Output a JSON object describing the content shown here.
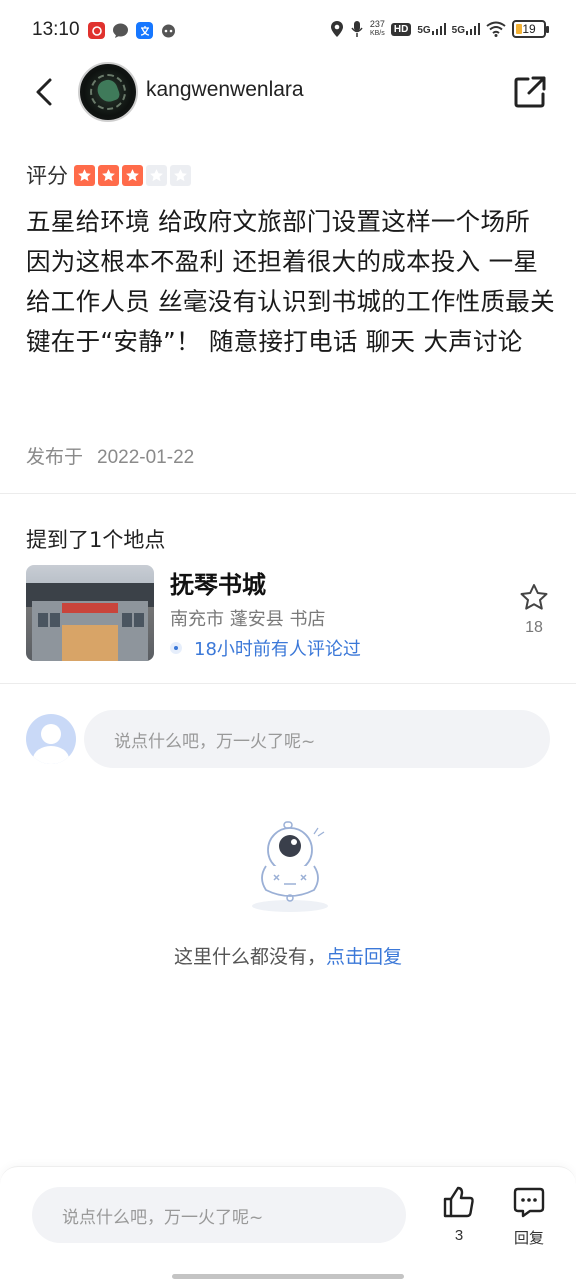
{
  "status_bar": {
    "time": "13:10",
    "speed_value": "237",
    "speed_unit": "KB/s",
    "hd": "HD",
    "net1": "5G",
    "net2": "5G",
    "battery": "19"
  },
  "header": {
    "username": "kangwenwenlara"
  },
  "review": {
    "rating_label": "评分",
    "rating": 3,
    "rating_max": 5,
    "text": "五星给环境 给政府文旅部门设置这样一个场所 因为这根本不盈利 还担着很大的成本投入 一星给工作人员 丝毫没有认识到书城的工作性质最关键在于“安静”！ 随意接打电话 聊天 大声讨论",
    "published_label": "发布于",
    "published_date": "2022-01-22"
  },
  "places": {
    "title": "提到了1个地点",
    "items": [
      {
        "name": "抚琴书城",
        "meta": "南充市 蓬安县 书店",
        "activity": "18小时前有人评论过",
        "fav_count": "18"
      }
    ]
  },
  "comment": {
    "placeholder": "说点什么吧，万一火了呢~"
  },
  "empty_state": {
    "text": "这里什么都没有，",
    "link": "点击回复"
  },
  "bottom_bar": {
    "placeholder": "说点什么吧，万一火了呢~",
    "like_count": "3",
    "reply_label": "回复"
  },
  "colors": {
    "accent": "#3b78d8",
    "star_on": "#ff6b4a",
    "star_off": "#eceef2"
  }
}
